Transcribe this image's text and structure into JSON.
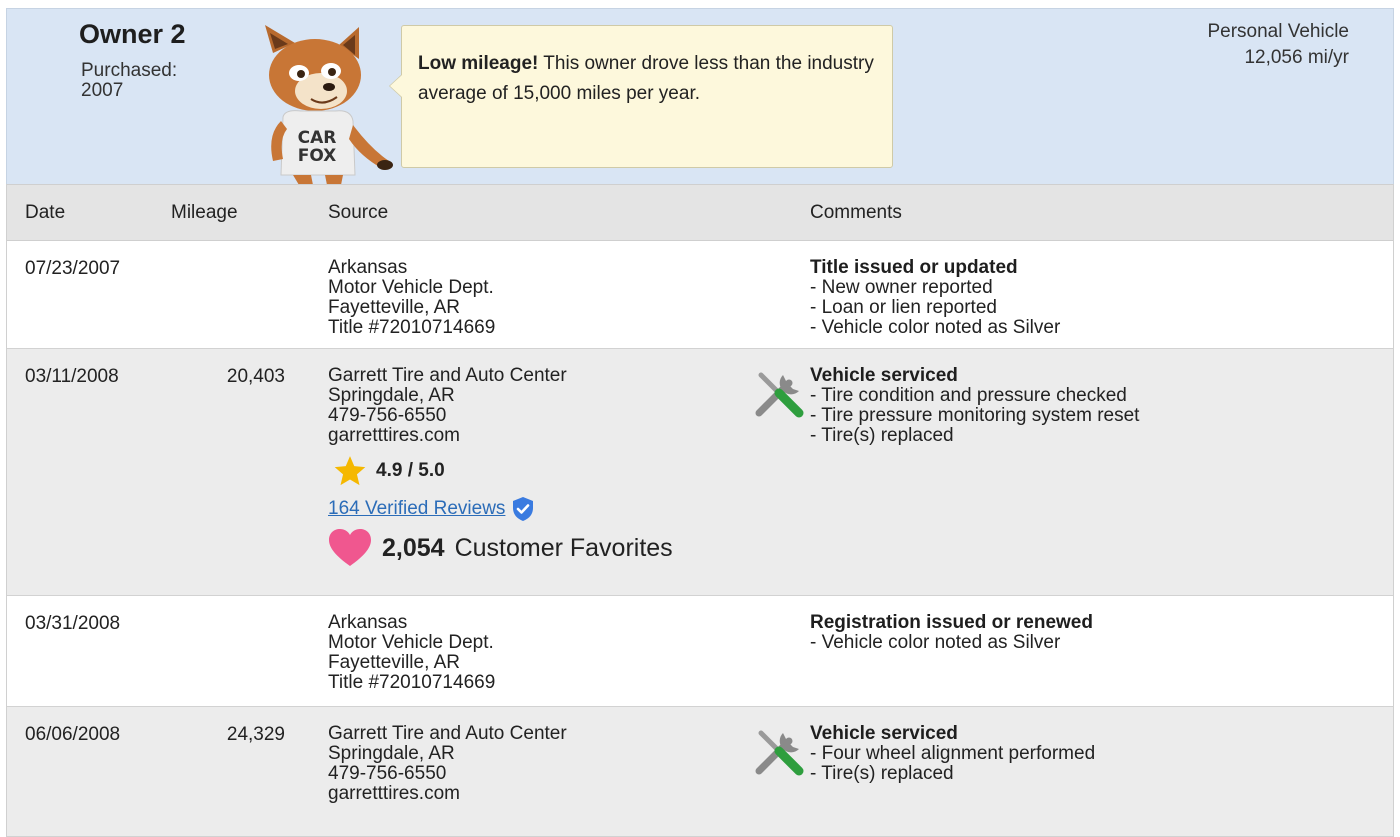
{
  "owner": {
    "title": "Owner 2",
    "purchased": "Purchased: 2007",
    "vehicle_type": "Personal Vehicle",
    "mileage_per_year": "12,056 mi/yr",
    "fox_shirt_text": "CAR FOX",
    "callout": {
      "bold": "Low mileage!",
      "text": " This owner drove less than the industry average of 15,000 miles per year."
    }
  },
  "table": {
    "headers": {
      "date": "Date",
      "mileage": "Mileage",
      "source": "Source",
      "comments": "Comments"
    },
    "rows": [
      {
        "date": "07/23/2007",
        "mileage": "",
        "source": [
          "Arkansas",
          "Motor Vehicle Dept.",
          "Fayetteville, AR",
          "Title #72010714669"
        ],
        "comment_title": "Title issued or updated",
        "comments": [
          "- New owner reported",
          "- Loan or lien reported",
          "- Vehicle color noted as Silver"
        ]
      },
      {
        "date": "03/11/2008",
        "mileage": "20,403",
        "source": [
          "Garrett Tire and Auto Center",
          "Springdale, AR",
          "479-756-6550",
          "garretttires.com"
        ],
        "comment_title": "Vehicle serviced",
        "comments": [
          "- Tire condition and pressure checked",
          "- Tire pressure monitoring system reset",
          "- Tire(s) replaced"
        ],
        "rating": "4.9 / 5.0",
        "reviews": "164 Verified Reviews",
        "favorites_count": "2,054",
        "favorites_label": "Customer Favorites",
        "icon": "wrench-screwdriver-icon"
      },
      {
        "date": "03/31/2008",
        "mileage": "",
        "source": [
          "Arkansas",
          "Motor Vehicle Dept.",
          "Fayetteville, AR",
          "Title #72010714669"
        ],
        "comment_title": "Registration issued or renewed",
        "comments": [
          "- Vehicle color noted as Silver"
        ]
      },
      {
        "date": "06/06/2008",
        "mileage": "24,329",
        "source": [
          "Garrett Tire and Auto Center",
          "Springdale, AR",
          "479-756-6550",
          "garretttires.com"
        ],
        "comment_title": "Vehicle serviced",
        "comments": [
          "- Four wheel alignment performed",
          "- Tire(s) replaced"
        ],
        "icon": "wrench-screwdriver-icon"
      }
    ]
  },
  "colors": {
    "header_bg": "#d9e5f4",
    "callout_bg": "#fdf8dc",
    "link": "#2b6cb8",
    "star": "#f5b800",
    "heart": "#f0578f",
    "verified": "#3a7be0",
    "screwdriver_handle": "#2e9e3e"
  }
}
